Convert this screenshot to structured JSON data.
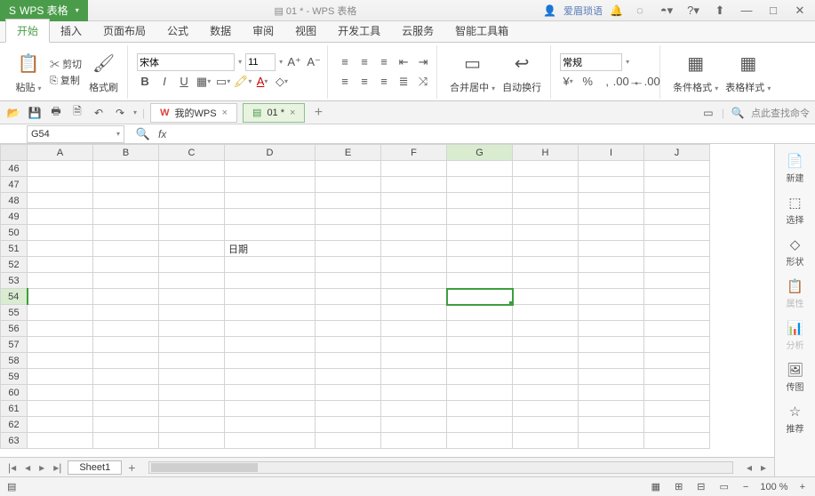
{
  "app": {
    "name": "WPS 表格",
    "doc_title": "01 * - WPS 表格"
  },
  "user": {
    "name": "爱眉琐语"
  },
  "window": {
    "min": "—",
    "max": "□",
    "close": "✕",
    "up": "⬆"
  },
  "menu": {
    "items": [
      "开始",
      "插入",
      "页面布局",
      "公式",
      "数据",
      "审阅",
      "视图",
      "开发工具",
      "云服务",
      "智能工具箱"
    ],
    "active_index": 0
  },
  "ribbon": {
    "paste": "粘贴",
    "cut": "剪切",
    "copy": "复制",
    "format_painter": "格式刷",
    "font_name": "宋体",
    "font_size": "11",
    "merge_center": "合并居中",
    "wrap_text": "自动换行",
    "number_format": "常规",
    "cond_format": "条件格式",
    "table_style": "表格样式"
  },
  "qa": {
    "tab1": "我的WPS",
    "tab2": "01 *",
    "add": "+",
    "search_placeholder": "点此查找命令"
  },
  "formula": {
    "cell_ref": "G54",
    "fx": "fx",
    "value": ""
  },
  "columns": [
    "A",
    "B",
    "C",
    "D",
    "E",
    "F",
    "G",
    "H",
    "I",
    "J"
  ],
  "row_start": 46,
  "row_end": 63,
  "cells": {
    "D51": "日期"
  },
  "active_cell": {
    "col": "G",
    "row": 54
  },
  "sheet_tabs": {
    "sheet1": "Sheet1",
    "add": "+"
  },
  "side": {
    "items": [
      {
        "icon": "📄",
        "label": "新建"
      },
      {
        "icon": "⬚",
        "label": "选择"
      },
      {
        "icon": "◇",
        "label": "形状"
      },
      {
        "icon": "📋",
        "label": "属性",
        "dim": true
      },
      {
        "icon": "📊",
        "label": "分析",
        "dim": true
      },
      {
        "icon": "🖼",
        "label": "传图"
      },
      {
        "icon": "☆",
        "label": "推荐"
      }
    ]
  },
  "status": {
    "zoom": "100 %",
    "minus": "−",
    "plus": "+"
  }
}
